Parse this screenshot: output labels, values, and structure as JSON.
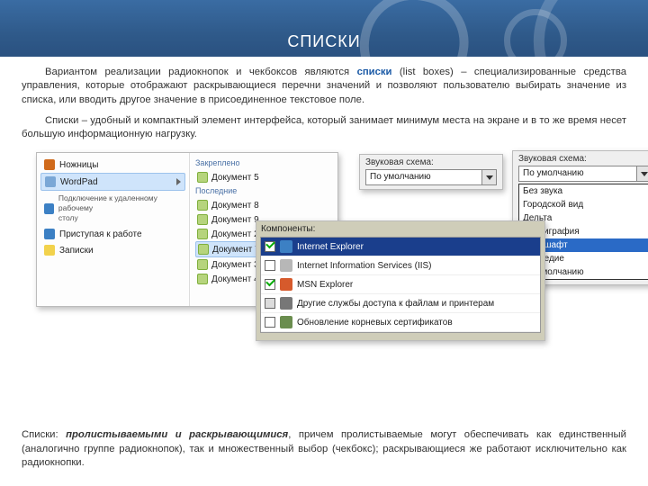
{
  "banner": {
    "title": "СПИСКИ"
  },
  "para1": {
    "pre": "Вариантом реализации радиокнопок и чекбоксов являются ",
    "kw": "списки",
    "post": " (list boxes) – специализированные  средства управления, которые отображают раскрывающиеся перечни значений и позволяют пользователю выбирать значение из списка, или вводить другое значение в присоединенное текстовое поле."
  },
  "para2": "Списки – удобный и компактный элемент интерфейса, который занимает минимум места на экране и в то же время несет большую информационную нагрузку.",
  "w1": {
    "left": {
      "i0": "Ножницы",
      "i1": "WordPad",
      "i2a": "Подключение к удаленному рабочему",
      "i2b": "столу",
      "i3": "Приступая к работе",
      "i4": "Записки"
    },
    "right": {
      "hdr1": "Закреплено",
      "d5": "Документ 5",
      "hdr2": "Последние",
      "d8": "Документ 8",
      "d9": "Документ 9",
      "d2": "Документ 2",
      "d7": "Документ 7",
      "d3": "Документ 3",
      "d4": "Документ 4"
    }
  },
  "w2": {
    "label": "Звуковая схема:",
    "value": "По умолчанию"
  },
  "w3": {
    "label": "Звуковая схема:",
    "value": "По умолчанию",
    "options": {
      "o0": "Без звука",
      "o1": "Городской вид",
      "o2": "Дельта",
      "o3": "Каллиграфия",
      "o4": "Ландшафт",
      "o5": "Наследие",
      "o6": "По умолчанию"
    }
  },
  "w4": {
    "title": "Компоненты:",
    "rows": {
      "r0": "Internet Explorer",
      "r1": "Internet Information Services (IIS)",
      "r2": "MSN Explorer",
      "r3": "Другие службы доступа к файлам и принтерам",
      "r4": "Обновление корневых сертификатов"
    }
  },
  "bottom": {
    "pre": "Списки: ",
    "bi": "пролистываемыми и раскрывающимися",
    "post": ", причем пролистываемые могут обеспечивать как единственный (аналогично группе радиокнопок), так и множественный выбор (чекбокс); раскрывающиеся же работают исключительно как радиокнопки."
  }
}
